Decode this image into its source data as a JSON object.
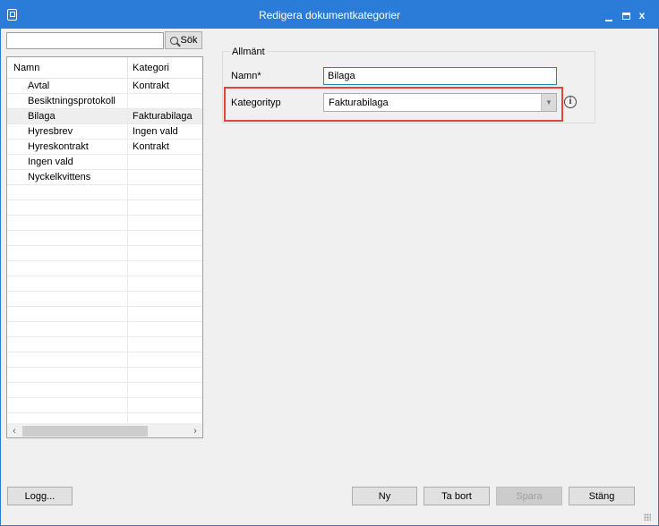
{
  "window": {
    "title": "Redigera dokumentkategorier",
    "accent_color": "#2b7bd8",
    "icon": "app-window-icon",
    "controls": {
      "minimize_icon": "minimize-icon",
      "maximize_icon": "maximize-icon",
      "close_label": "x"
    }
  },
  "search": {
    "value": "",
    "button_label": "Sök",
    "icon": "search-icon"
  },
  "grid": {
    "columns": [
      "Namn",
      "Kategori"
    ],
    "selected_index": 2,
    "rows": [
      {
        "name": "Avtal",
        "category": "Kontrakt"
      },
      {
        "name": "Besiktningsprotokoll",
        "category": ""
      },
      {
        "name": "Bilaga",
        "category": "Fakturabilaga"
      },
      {
        "name": "Hyresbrev",
        "category": "Ingen vald"
      },
      {
        "name": "Hyreskontrakt",
        "category": "Kontrakt"
      },
      {
        "name": "Ingen vald",
        "category": ""
      },
      {
        "name": "Nyckelkvittens",
        "category": ""
      }
    ],
    "scroll_left_icon": "‹",
    "scroll_right_icon": "›"
  },
  "details": {
    "group_title": "Allmänt",
    "name_label": "Namn*",
    "name_value": "Bilaga",
    "category_type_label": "Kategorityp",
    "category_type_value": "Fakturabilaga",
    "dropdown_arrow": "▼",
    "info_icon_glyph": "i",
    "highlight_color": "#e0463c"
  },
  "buttons": {
    "log": "Logg...",
    "new": "Ny",
    "delete": "Ta bort",
    "save": "Spara",
    "close": "Stäng"
  }
}
